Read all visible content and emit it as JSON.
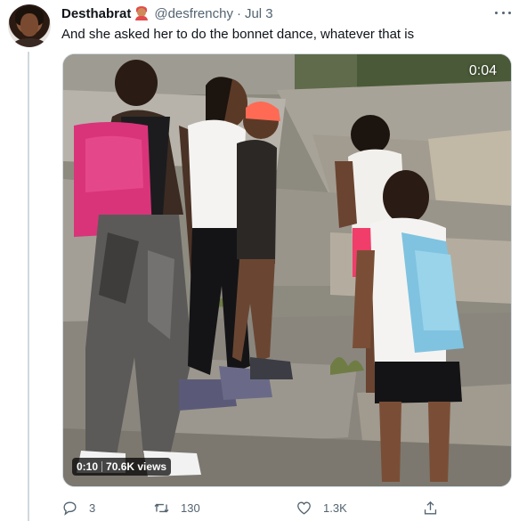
{
  "tweet": {
    "author_name": "Desthabrat",
    "author_emoji": "woman-red-hair-emoji",
    "handle": "@desfrenchy",
    "separator": "·",
    "date": "Jul 3",
    "text": "And she asked her to do the bonnet dance, whatever that is"
  },
  "video": {
    "timer": "0:04",
    "duration": "0:10",
    "views": "70.6K views"
  },
  "actions": {
    "reply_count": "3",
    "retweet_count": "130",
    "like_count": "1.3K"
  },
  "icons": {
    "reply": "reply-icon",
    "retweet": "retweet-icon",
    "like": "heart-icon",
    "share": "share-icon",
    "more": "more-options-icon"
  },
  "colors": {
    "text": "#0f1419",
    "secondary": "#536471",
    "border": "#cfd9de"
  }
}
